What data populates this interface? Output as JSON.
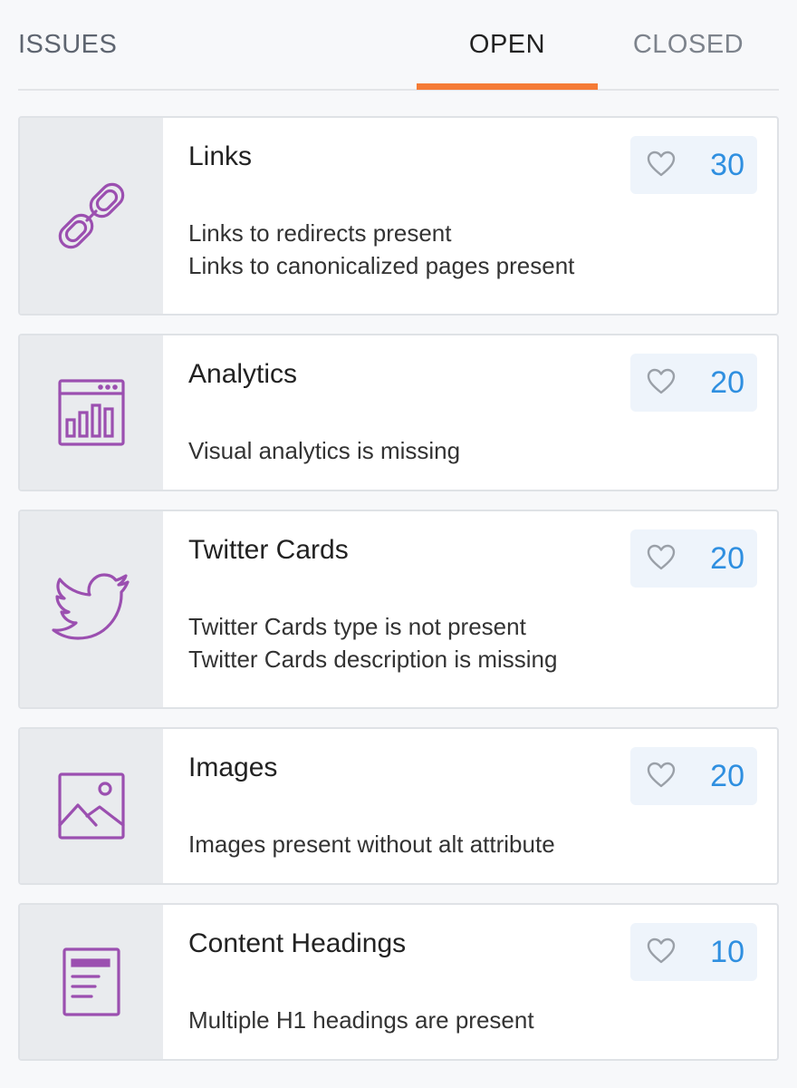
{
  "header": {
    "title": "ISSUES",
    "tabs": {
      "open": "OPEN",
      "closed": "CLOSED"
    },
    "active_tab": "open",
    "accent_color": "#f57b35"
  },
  "issues": [
    {
      "icon": "link-icon",
      "title": "Links",
      "count": "30",
      "lines": [
        "Links to redirects present",
        "Links to canonicalized pages present"
      ]
    },
    {
      "icon": "analytics-icon",
      "title": "Analytics",
      "count": "20",
      "lines": [
        "Visual analytics is missing"
      ]
    },
    {
      "icon": "twitter-icon",
      "title": "Twitter Cards",
      "count": "20",
      "lines": [
        "Twitter Cards type is not present",
        "Twitter Cards description is missing"
      ]
    },
    {
      "icon": "image-icon",
      "title": "Images",
      "count": "20",
      "lines": [
        "Images present without alt attribute"
      ]
    },
    {
      "icon": "document-icon",
      "title": "Content Headings",
      "count": "10",
      "lines": [
        "Multiple H1 headings are present"
      ]
    }
  ],
  "colors": {
    "icon": "#9b4fb0",
    "count": "#2f8fe0"
  }
}
